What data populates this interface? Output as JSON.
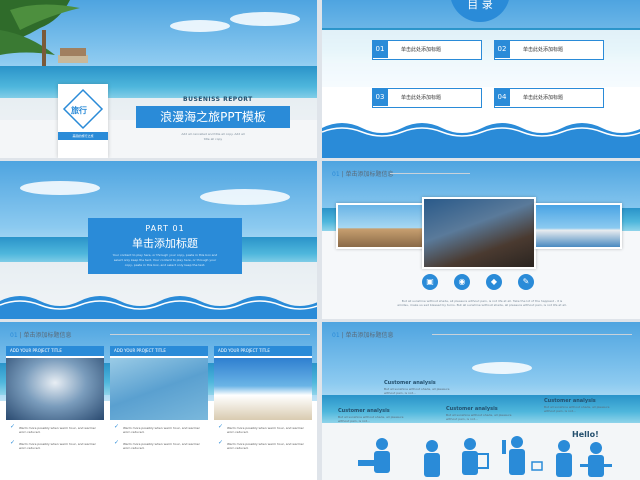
{
  "slide1": {
    "logo_title": "旅行",
    "logo_sub": "美丽的旅行之旅",
    "report": "BUSENISS REPORT",
    "title": "浪漫海之旅PPT模板",
    "subtitle_line1": "Add all cancelled and title all copy. Add all",
    "subtitle_line2": "title all copy",
    "colors": {
      "accent": "#2a8bd8"
    }
  },
  "slide2": {
    "toc_title": "目 录",
    "items": [
      {
        "num": "01",
        "text": "单击此处添加标题"
      },
      {
        "num": "02",
        "text": "单击此处添加标题"
      },
      {
        "num": "03",
        "text": "单击此处添加标题"
      },
      {
        "num": "04",
        "text": "单击此处添加标题"
      }
    ]
  },
  "slide3": {
    "part": "PART 01",
    "title": "单击添加标题",
    "desc_line1": "Your content to play here, or through your copy, paste in this box and",
    "desc_line2": "select only keep the text. Your content to play here, or through your",
    "desc_line3": "copy, paste in this box, and select only keep the text."
  },
  "slide4": {
    "num": "01",
    "title": "单击添加标题信息",
    "icons": [
      "building-icon",
      "camera-icon",
      "tag-icon",
      "brush-icon"
    ],
    "caption_line1": "But all sunshine without shade, all pleasure without pain, is not life at all. Take the lot of the happiest - it is",
    "caption_line2": "amidsu, make us sad blessed by turns.  But all sunshine without shade, all pleasure without pain, is not life at all."
  },
  "slide5": {
    "num": "01",
    "title": "单击添加标题信息",
    "cards": [
      {
        "head": "ADD YOUR PROJECT TITLE",
        "lines": [
          "Warm more possibly when warm hour, and warmer",
          "worn reduced.",
          "Warm more possibly when warm hour, and warmer",
          "worn reduced."
        ]
      },
      {
        "head": "ADD YOUR PROJECT TITLE",
        "lines": [
          "Warm more possibly when warm hour, and warmer",
          "worn reduced.",
          "Warm more possibly when warm hour, and warmer",
          "worn reduced."
        ]
      },
      {
        "head": "ADD YOUR PROJECT TITLE",
        "lines": [
          "Warm more possibly when warm hour, and warmer",
          "worn reduced.",
          "Warm more possibly when warm hour, and warmer",
          "worn reduced."
        ]
      }
    ]
  },
  "slide6": {
    "num": "01",
    "title": "单击添加标题信息",
    "hello": "Hello!",
    "labels": [
      {
        "title": "Customer analysis",
        "desc": "But all sunshine without shade, all pleasure without pain, is not..."
      },
      {
        "title": "Customer analysis",
        "desc": "But all sunshine without shade, all pleasure without pain, is not..."
      },
      {
        "title": "Customer analysis",
        "desc": "But all sunshine without shade, all pleasure without pain, is not..."
      },
      {
        "title": "Customer analysis",
        "desc": "But all sunshine without shade, all pleasure without pain, is not..."
      }
    ]
  }
}
